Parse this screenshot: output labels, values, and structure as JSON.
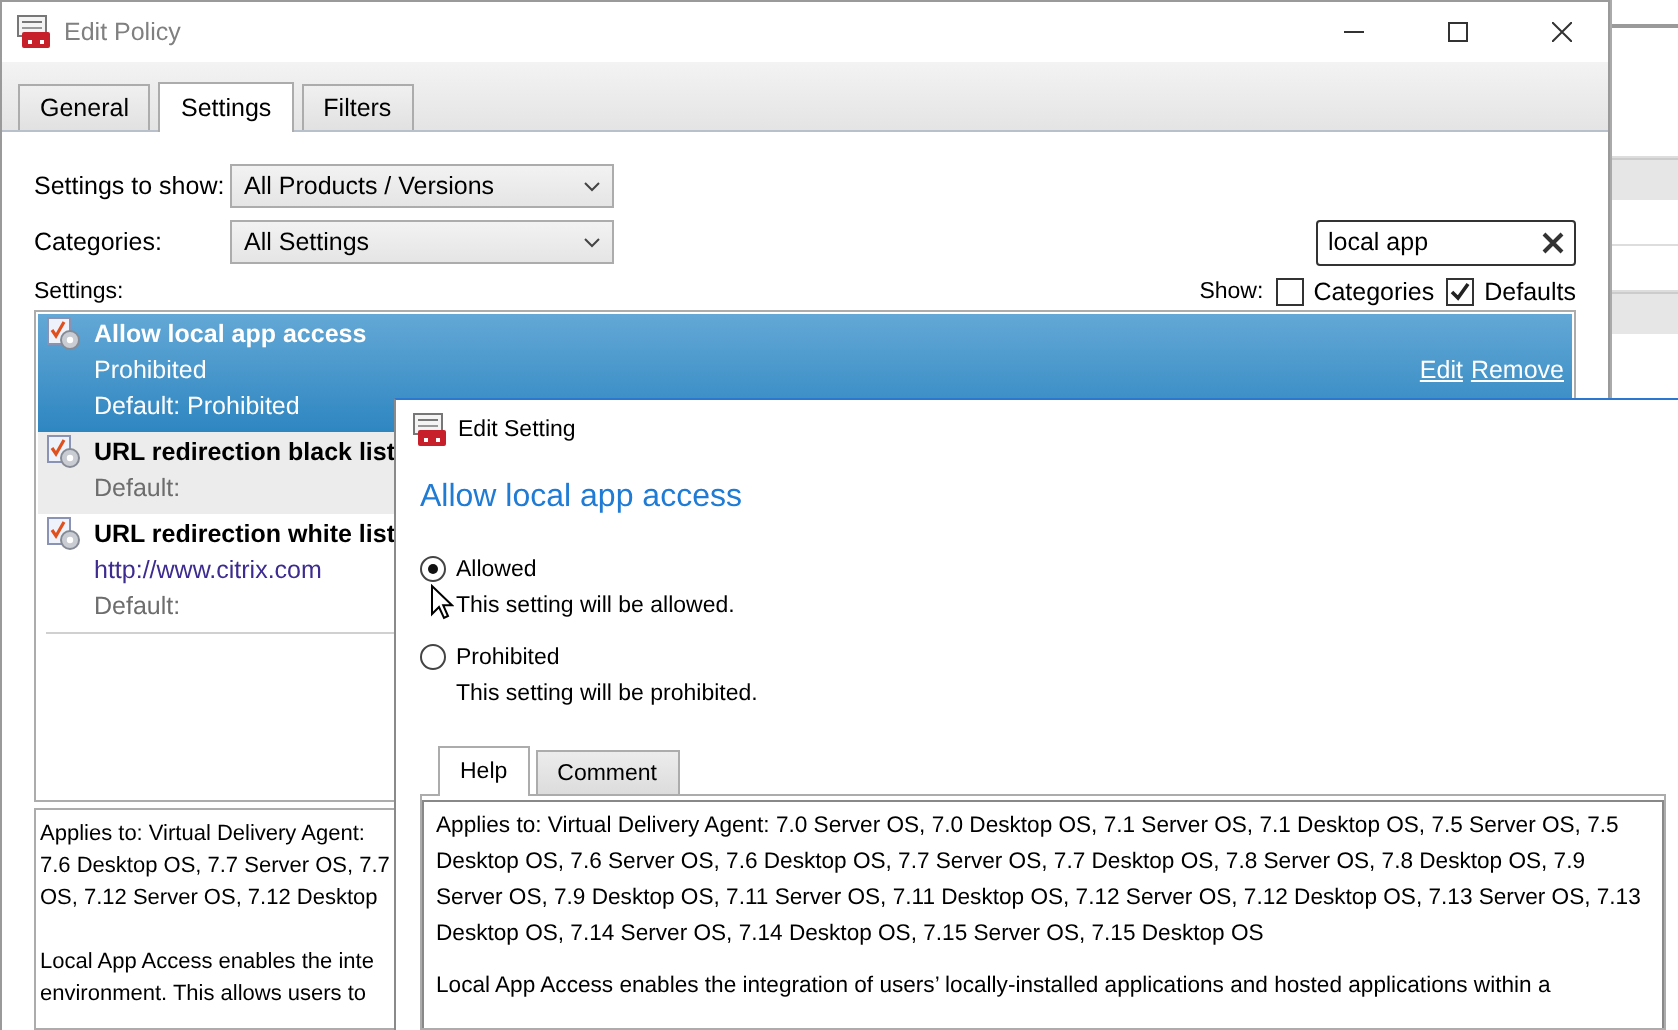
{
  "edit_policy": {
    "title": "Edit Policy",
    "tabs": [
      {
        "label": "General",
        "selected": false
      },
      {
        "label": "Settings",
        "selected": true
      },
      {
        "label": "Filters",
        "selected": false
      }
    ],
    "settings_to_show": {
      "label": "Settings to show:",
      "value": "All Products / Versions"
    },
    "categories": {
      "label": "Categories:",
      "value": "All Settings"
    },
    "search": {
      "value": "local app"
    },
    "settings_label": "Settings:",
    "show": {
      "label": "Show:",
      "options": [
        {
          "label": "Categories",
          "checked": false
        },
        {
          "label": "Defaults",
          "checked": true
        }
      ]
    },
    "settings": [
      {
        "name": "Allow local app access",
        "value": "Prohibited",
        "default": "Default: Prohibited",
        "selected": true,
        "hovered": false,
        "actions": [
          "Edit",
          "Remove"
        ]
      },
      {
        "name": "URL redirection black list",
        "default": "Default:",
        "selected": false,
        "hovered": true
      },
      {
        "name": "URL redirection white list",
        "value": "http://www.citrix.com",
        "default": "Default:",
        "selected": false,
        "hovered": false
      }
    ],
    "help_lines": [
      "Applies to: Virtual Delivery Agent:",
      "7.6 Desktop OS, 7.7 Server OS, 7.7",
      "OS, 7.12 Server OS, 7.12 Desktop"
    ],
    "help_lines_2": [
      "Local App Access enables the inte",
      "environment. This allows users to"
    ]
  },
  "edit_setting": {
    "title": "Edit Setting",
    "heading": "Allow local app access",
    "options": [
      {
        "label": "Allowed",
        "description": "This setting will be allowed.",
        "selected": true
      },
      {
        "label": "Prohibited",
        "description": "This setting will be prohibited.",
        "selected": false
      }
    ],
    "tabs": [
      {
        "label": "Help",
        "selected": true
      },
      {
        "label": "Comment",
        "selected": false
      }
    ],
    "help_paragraphs": [
      "Applies to: Virtual Delivery Agent: 7.0 Server OS, 7.0 Desktop OS, 7.1 Server OS, 7.1 Desktop OS, 7.5 Server OS, 7.5 Desktop OS, 7.6 Server OS, 7.6 Desktop OS, 7.7 Server OS, 7.7 Desktop OS, 7.8 Server OS, 7.8 Desktop OS, 7.9 Server OS, 7.9 Desktop OS, 7.11 Server OS, 7.11 Desktop OS, 7.12 Server OS, 7.12 Desktop OS, 7.13 Server OS, 7.13 Desktop OS, 7.14 Server OS, 7.14 Desktop OS, 7.15 Server OS, 7.15 Desktop OS",
      "Local App Access enables the integration of users’ locally-installed applications and hosted applications within a"
    ]
  }
}
